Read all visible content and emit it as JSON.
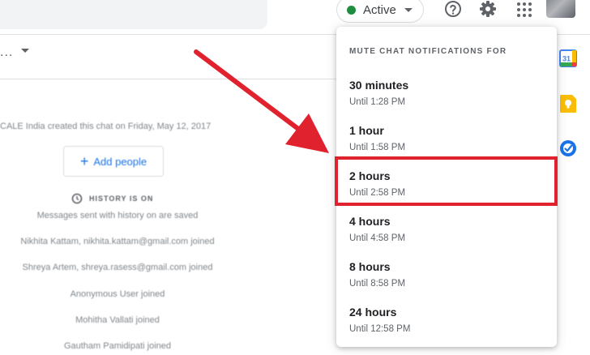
{
  "header": {
    "status_label": "Active",
    "status_color": "#1e8e3e",
    "icons": [
      "help-icon",
      "gear-icon",
      "apps-grid-icon"
    ]
  },
  "chat": {
    "creator_line": "CALE India created this chat on Friday, May 12, 2017",
    "add_people_label": "Add people",
    "history_label": "HISTORY IS ON",
    "history_note": "Messages sent with history on are saved",
    "joined_lines": [
      "Nikhita Kattam, nikhita.kattam@gmail.com joined",
      "Shreya Artem, shreya.rasess@gmail.com joined",
      "Anonymous User joined",
      "Mohitha Vallati joined",
      "Gautham Pamidipati joined"
    ]
  },
  "mute_menu": {
    "header": "MUTE CHAT NOTIFICATIONS FOR",
    "options": [
      {
        "title": "30 minutes",
        "until": "Until 1:28 PM"
      },
      {
        "title": "1 hour",
        "until": "Until 1:58 PM"
      },
      {
        "title": "2 hours",
        "until": "Until 2:58 PM"
      },
      {
        "title": "4 hours",
        "until": "Until 4:58 PM"
      },
      {
        "title": "8 hours",
        "until": "Until 8:58 PM"
      },
      {
        "title": "24 hours",
        "until": "Until 12:58 PM"
      }
    ],
    "highlighted_index": 2,
    "highlight_color": "#e0222e"
  },
  "right_rail": {
    "icons": [
      "calendar-icon",
      "keep-icon",
      "tasks-icon"
    ],
    "calendar_day": "31"
  }
}
